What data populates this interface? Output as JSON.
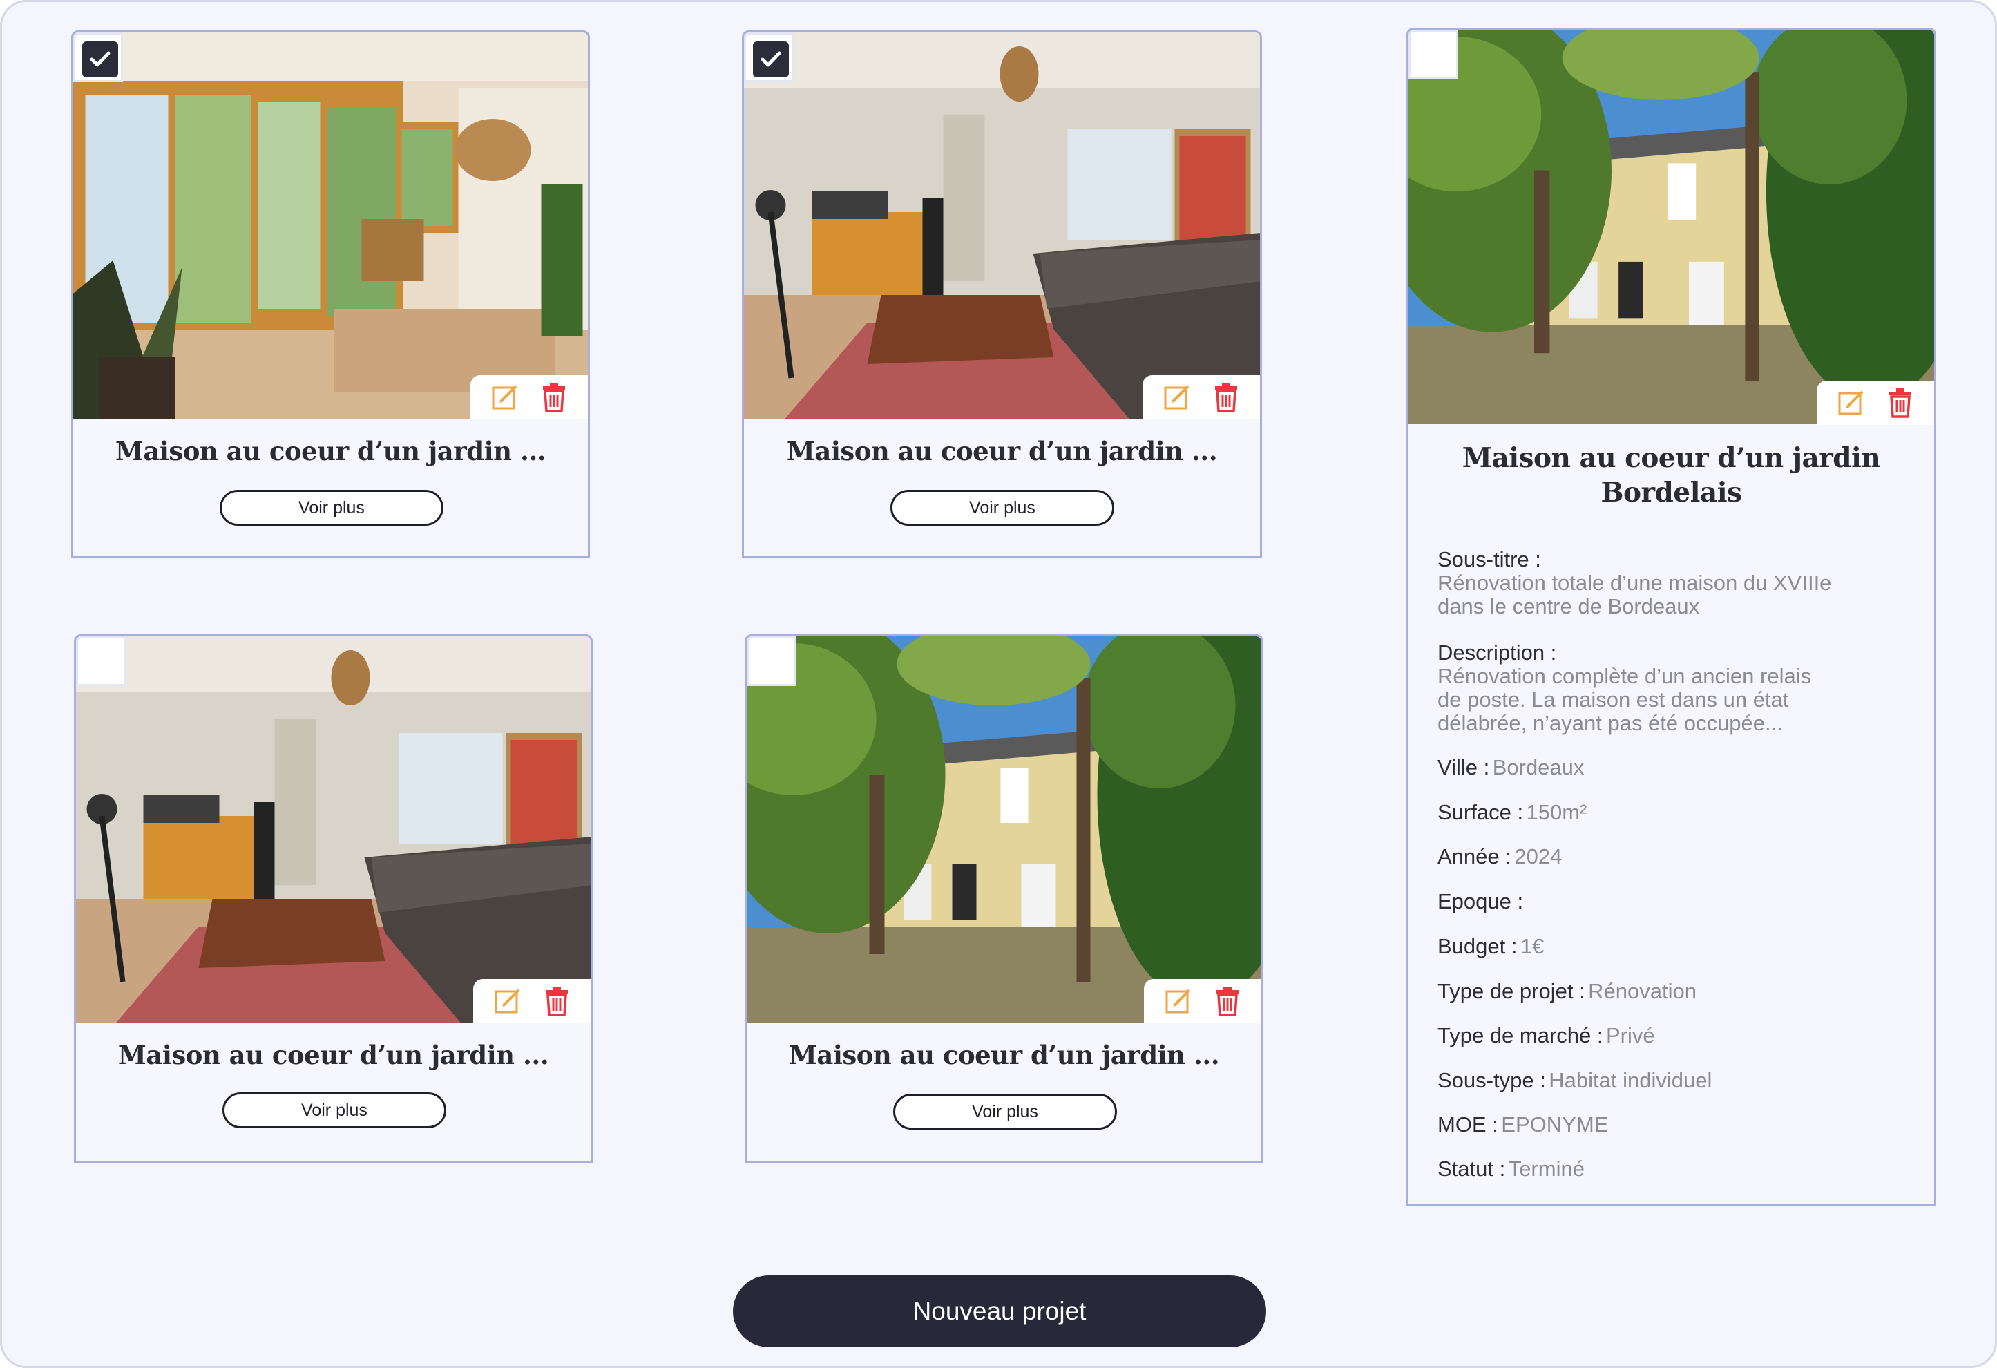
{
  "cards": [
    {
      "title": "Maison au coeur d’un jardin ...",
      "checked": true,
      "button_label": "Voir plus",
      "image": "living-room-with-garden-doors",
      "edit_icon": "edit-icon",
      "delete_icon": "trash-icon"
    },
    {
      "title": "Maison au coeur d’un jardin ...",
      "checked": true,
      "button_label": "Voir plus",
      "image": "living-room-with-sofa",
      "edit_icon": "edit-icon",
      "delete_icon": "trash-icon"
    },
    {
      "title": "Maison au coeur d’un jardin ...",
      "checked": false,
      "button_label": "Voir plus",
      "image": "living-room-with-sofa",
      "edit_icon": "edit-icon",
      "delete_icon": "trash-icon"
    },
    {
      "title": "Maison au coeur d’un jardin ...",
      "checked": false,
      "button_label": "Voir plus",
      "image": "house-facade-in-garden",
      "edit_icon": "edit-icon",
      "delete_icon": "trash-icon"
    }
  ],
  "detail_card": {
    "checked": false,
    "image": "house-facade-in-garden",
    "title_line1": "Maison au coeur d’un jardin",
    "title_line2": "Bordelais",
    "subtitle_label": "Sous-titre :",
    "subtitle_line1": "Rénovation totale d’une maison du XVIIIe",
    "subtitle_line2": "dans le centre de Bordeaux",
    "description_label": "Description :",
    "description_line1": "Rénovation complète d’un ancien relais",
    "description_line2": "de poste. La maison est dans un état",
    "description_line3": "délabrée, n’ayant pas été occupée...",
    "fields": [
      {
        "label": "Ville :",
        "value": "Bordeaux"
      },
      {
        "label": "Surface :",
        "value": "150m²"
      },
      {
        "label": "Année :",
        "value": "2024"
      },
      {
        "label": "Epoque :",
        "value": ""
      },
      {
        "label": "Budget :",
        "value": "1€"
      },
      {
        "label": "Type de projet :",
        "value": "Rénovation"
      },
      {
        "label": "Type de marché :",
        "value": "Privé"
      },
      {
        "label": "Sous-type :",
        "value": "Habitat individuel"
      },
      {
        "label": "MOE :",
        "value": "EPONYME"
      },
      {
        "label": "Statut :",
        "value": "Terminé"
      }
    ]
  },
  "new_project_button": "Nouveau projet",
  "colors": {
    "edit": "#f2a541",
    "delete": "#e8373f",
    "dark": "#272938",
    "border": "#a9aee0"
  }
}
